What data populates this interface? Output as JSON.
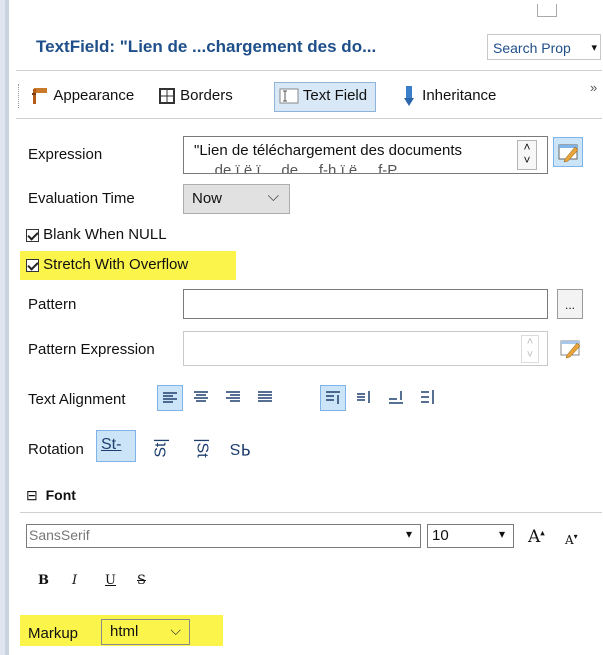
{
  "header": {
    "title": "TextField: \"Lien de ...chargement des do...",
    "search_label": "Search Prop",
    "search_arrow": "▾",
    "overflow_glyph": "»"
  },
  "tabs": [
    {
      "label": "Appearance",
      "icon": "paint-roller-icon"
    },
    {
      "label": "Borders",
      "icon": "borders-icon"
    },
    {
      "label": "Text Field",
      "icon": "text-field-icon",
      "active": true
    },
    {
      "label": "Inheritance",
      "icon": "inheritance-icon"
    }
  ],
  "expression": {
    "label": "Expression",
    "value": "\"Lien de téléchargement des documents",
    "value_line2": "... de ï ë ï ... de ... f-h ï ë ... f-P ...",
    "spin_up": "˄",
    "spin_down": "˅"
  },
  "evaluation_time": {
    "label": "Evaluation Time",
    "value": "Now",
    "arrow": "⌵"
  },
  "blank_when_null": {
    "label": "Blank When NULL",
    "checked": true
  },
  "stretch_with_overflow": {
    "label": "Stretch With Overflow",
    "checked": true
  },
  "pattern": {
    "label": "Pattern",
    "value": "",
    "button": "..."
  },
  "pattern_expression": {
    "label": "Pattern Expression",
    "value": ""
  },
  "text_alignment": {
    "label": "Text Alignment"
  },
  "rotation": {
    "label": "Rotation",
    "options": [
      "St-",
      "St|",
      "|St",
      "ꟼS"
    ]
  },
  "font_section": {
    "label": "Font",
    "toggle": "⊟",
    "family": "SansSerif",
    "size": "10",
    "arrow": "▾",
    "increase": "A",
    "decrease": "A",
    "styles": [
      "B",
      "I",
      "U",
      "S"
    ]
  },
  "markup": {
    "label": "Markup",
    "value": "html",
    "arrow": "⌵"
  },
  "colors": {
    "highlight": "#fbf54b",
    "title": "#1f4f8a",
    "active_tab": "#d9e8f6"
  }
}
